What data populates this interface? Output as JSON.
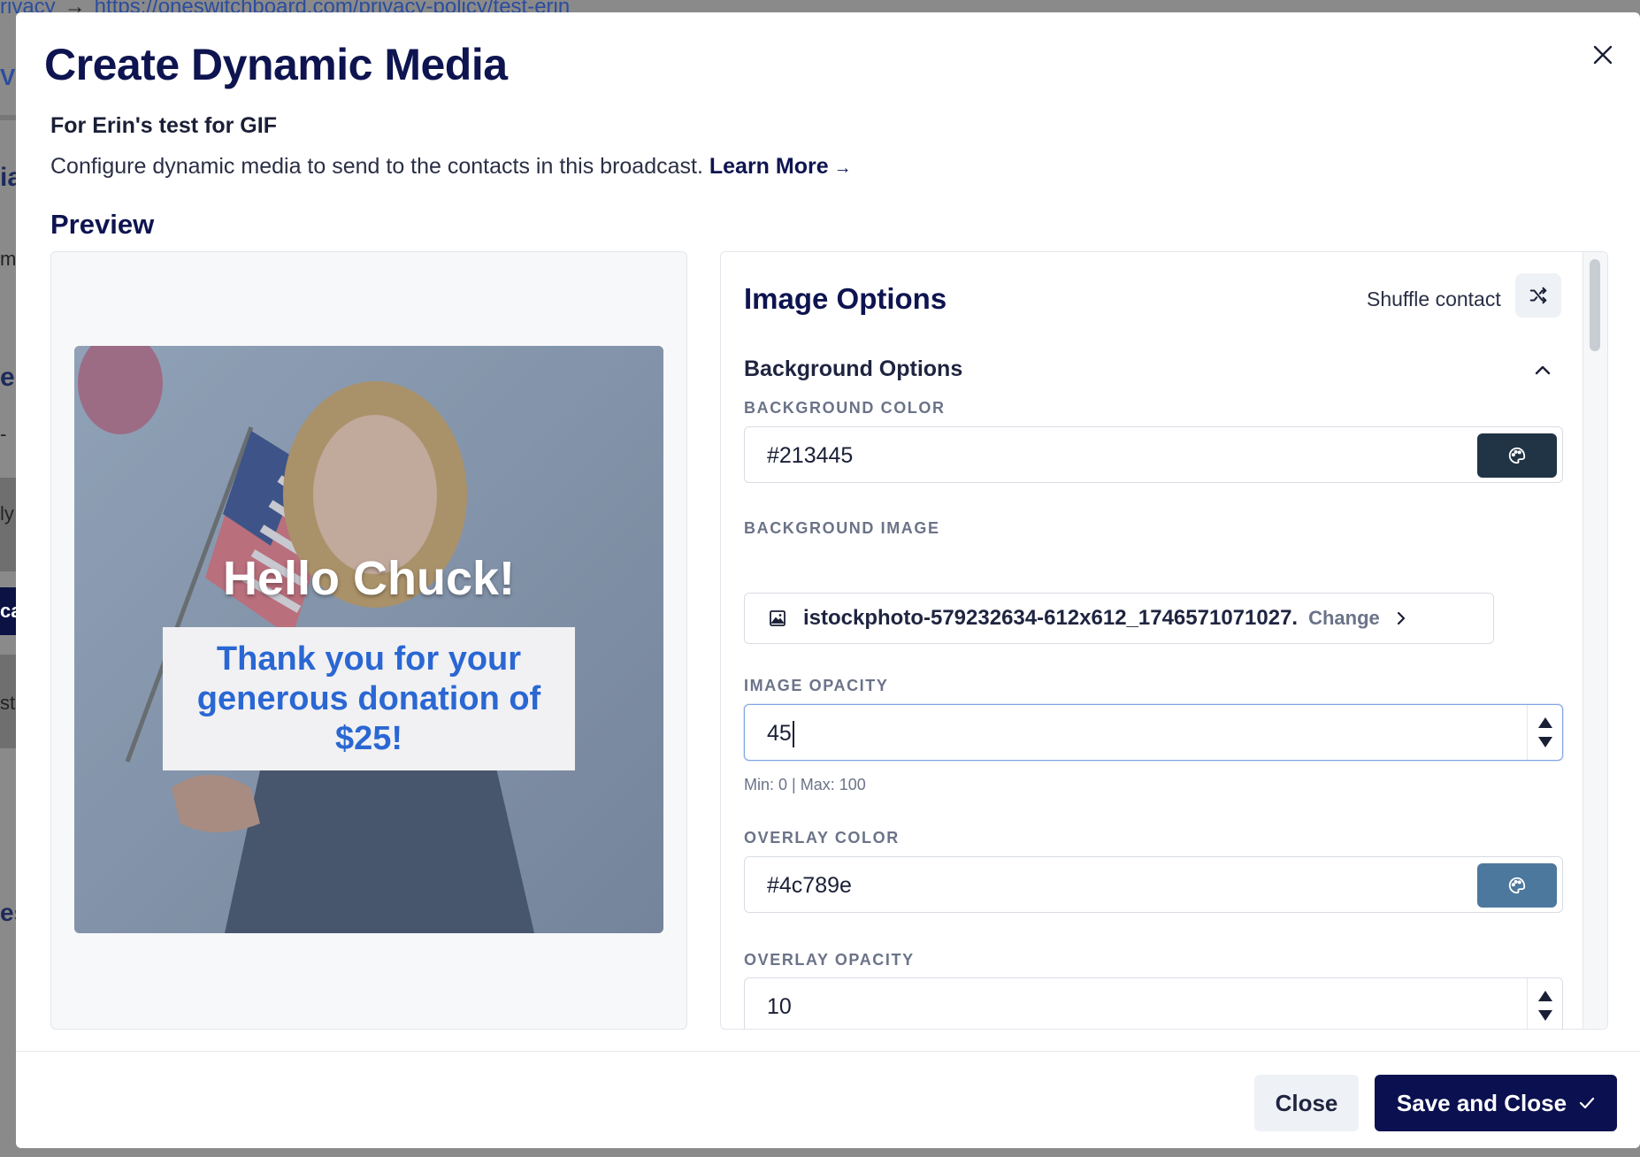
{
  "backdrop": {
    "url_prefix": "rivacy",
    "url_arrow": "→",
    "url_link": "https://oneswitchboard.com/privacy-policy/test-erin",
    "fragments": [
      "Vi",
      "ia",
      "ma",
      "e I",
      "-",
      "ly",
      "ca",
      "st",
      "es"
    ]
  },
  "modal": {
    "title": "Create Dynamic Media",
    "subtitle": "For Erin's test for GIF",
    "description": "Configure dynamic media to send to the contacts in this broadcast.",
    "learn_more": "Learn More",
    "learn_more_arrow": "→",
    "preview_heading": "Preview"
  },
  "preview": {
    "greeting": "Hello Chuck!",
    "message": "Thank you for your generous donation of $25!",
    "background_color": "#213445",
    "overlay_color": "#4c789e",
    "overlay_opacity_percent": 10,
    "image_opacity_percent": 45
  },
  "options": {
    "title": "Image Options",
    "shuffle_label": "Shuffle contact",
    "section_title": "Background Options",
    "background_color": {
      "label": "BACKGROUND COLOR",
      "value": "#213445",
      "swatch": "#213445"
    },
    "background_image": {
      "label": "BACKGROUND IMAGE",
      "file_name": "istockphoto-579232634-612x612_1746571071027.",
      "change_label": "Change"
    },
    "image_opacity": {
      "label": "IMAGE OPACITY",
      "value": "45",
      "hint": "Min: 0 | Max: 100"
    },
    "overlay_color": {
      "label": "OVERLAY COLOR",
      "value": "#4c789e",
      "swatch": "#4c789e"
    },
    "overlay_opacity": {
      "label": "OVERLAY OPACITY",
      "value": "10"
    }
  },
  "footer": {
    "close_label": "Close",
    "save_label": "Save and Close"
  },
  "icons": {
    "modal_close": "close-icon",
    "shuffle": "shuffle-icon",
    "collapse": "chevron-up-icon",
    "palette": "palette-icon",
    "image": "image-icon",
    "change_arrow": "chevron-right-icon",
    "save_check": "check-icon"
  }
}
